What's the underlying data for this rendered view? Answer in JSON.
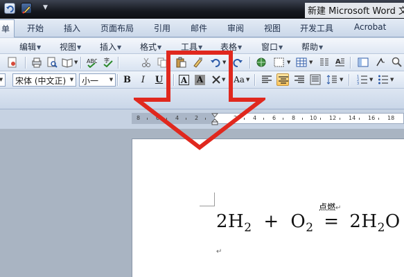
{
  "window": {
    "title": "新建 Microsoft Word 文"
  },
  "ribbon_tabs": [
    {
      "label": "单",
      "active": true
    },
    {
      "label": "开始"
    },
    {
      "label": "插入"
    },
    {
      "label": "页面布局"
    },
    {
      "label": "引用"
    },
    {
      "label": "邮件"
    },
    {
      "label": "审阅"
    },
    {
      "label": "视图"
    },
    {
      "label": "开发工具"
    },
    {
      "label": "Acrobat"
    }
  ],
  "menus": [
    "编辑",
    "视图",
    "插入",
    "格式",
    "工具",
    "表格",
    "窗口",
    "帮助"
  ],
  "formatting": {
    "font_name": "宋体 (中文正)",
    "font_size": "小一",
    "bold": "B",
    "italic": "I",
    "underline": "U",
    "char_border": "A",
    "char_shading": "A",
    "change_case": "Aa"
  },
  "ruler": {
    "numbers": [
      "8",
      "6",
      "4",
      "2",
      "2",
      "4",
      "6",
      "8",
      "10",
      "12",
      "14",
      "16",
      "18"
    ]
  },
  "document": {
    "annotation": "点燃",
    "annotation_mark": "↵",
    "equation": {
      "coef1": "2H",
      "sub1": "2",
      "plus": "+",
      "o": "O",
      "sub2": "2",
      "equals": "=",
      "coef2": "2H",
      "sub3": "2",
      "tail": "O"
    },
    "paragraph_mark": "↵"
  },
  "colors": {
    "arrow_red": "#e0281e",
    "accent_blue": "#2b579a"
  }
}
